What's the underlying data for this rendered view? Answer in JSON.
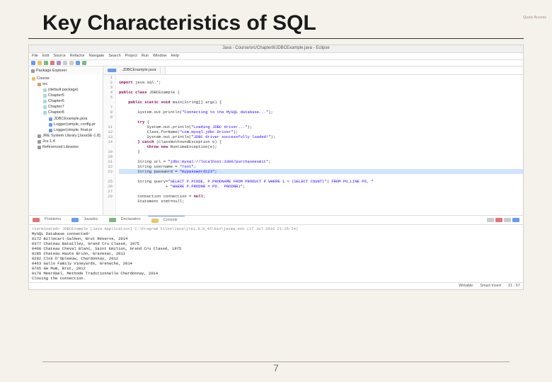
{
  "slide": {
    "title": "Key Characteristics of SQL",
    "page_number": "7"
  },
  "ide": {
    "window_title": "Java - Course/src/Chapter8/JDBCExample.java - Eclipse",
    "menu": [
      "File",
      "Edit",
      "Source",
      "Refactor",
      "Navigate",
      "Search",
      "Project",
      "Run",
      "Window",
      "Help"
    ],
    "quick_access": "Quick Access",
    "pkg_explorer": {
      "title": "Package Explorer",
      "project": "Course",
      "src": "src",
      "items": [
        "(default package)",
        "Chapter5",
        "Chapter6",
        "Chapter7",
        "Chapter8"
      ],
      "files": [
        "JDBCExample.java",
        "Logger(simple, config.pr",
        "Logger(simple, final.pr"
      ],
      "libs": [
        "JRE System Library [JavaSE-1.8]",
        "Jcs-1.4",
        "Referenced Libraries"
      ]
    },
    "tab_label": "JDBCExample.java",
    "lines": [
      "1",
      "2",
      "3",
      "4",
      "5",
      "",
      "7",
      "8",
      "9",
      "",
      "11",
      "12",
      "13",
      "14",
      "",
      "19",
      "20",
      "21",
      "22",
      "23",
      "",
      "25",
      "26",
      "27",
      "28"
    ],
    "code": {
      "l2": {
        "k": "import",
        "t": " java.sql.*;"
      },
      "l4": {
        "k": "public class",
        "t": " JDBCExample {"
      },
      "l7": {
        "k": "public static void",
        "t": " main(String[] args) {"
      },
      "l8": {
        "p": "        System.out.println(",
        "s": "\"Connecting to the MySQL database...\"",
        ");": ");"
      },
      "l9": {
        "k": "        try",
        "t": " {"
      },
      "l11": {
        "p": "            System.out.println(",
        "s": "\"Loading JDBC driver...\"",
        "e": ");"
      },
      "l12": {
        "p": "            Class.forName(",
        "s": "\"com.mysql.jdbc.Driver\"",
        "e": ");"
      },
      "l13": {
        "p": "            System.out.println(",
        "s": "\"JDBC driver successfully loaded!\"",
        "e": ");"
      },
      "l14a": {
        "k": "        } catch",
        "t": " (ClassNotFoundException e) {"
      },
      "l14b": {
        "k": "            throw new",
        "t": " RuntimeException(e);"
      },
      "l15": {
        "t": "        }"
      },
      "l19": {
        "p": "        String url = ",
        "s": "\"jdbc:mysql://localhost:3306/purchaseexmit\"",
        "e": ";"
      },
      "l20": {
        "p": "        String username = ",
        "s": "\"root\"",
        "e": ";"
      },
      "l21": {
        "p": "        String password = ",
        "s": "\"mypassword123\"",
        "e": ";"
      },
      "l23a": {
        "p": "        String query=",
        "s": "\"SELECT P.PCODE, P.PRODNAME FROM PRODUCT P WHERE 1 < (SELECT COUNT(*) FROM PO_LINE PO, \""
      },
      "l23b": {
        "p": "                    + ",
        "s": "\"WHERE P.PRODNR = PO.  PRODNR)\"",
        "e": ";"
      },
      "l25": {
        "p": "        Connection connection = ",
        "k": "null",
        "e": ";"
      },
      "l26": {
        "p": "        Statement stmt=null;"
      }
    },
    "bottom_tabs": [
      "Problems",
      "Javadoc",
      "Declaration",
      "Console"
    ],
    "console": {
      "term": "<terminated> JDBCExample [Java Application] C:\\Program Files\\Java\\jre1.8.0_45\\bin\\javaw.exe (27 Jul 2016 21:25:24)",
      "lines": [
        "MySQL Database connected!",
        "0172  Billecart-Salmon, Brut Réserve, 2014",
        "0377  Chateau Batailley, Grand Cru Classé, 1975",
        "0468  Chateau Cheval Blanc, Saint Emilion, Grand Cru Classé, 1975",
        "0185  Chateau Haute Brion, Gravesac, 2011",
        "0282  Clos D'Opleeuw, Chardonnay, 2012",
        "0463  Gallo Family Vineyards, Grenache, 2014",
        "0765  GH Mum, Brut, 2012",
        "0178  Meerdael, Methode Traditionnelle Chardonnay, 2014",
        "Closing the connection."
      ]
    },
    "status": {
      "write": "Writable",
      "ins": "Smart Insert",
      "pos": "21 : 57"
    }
  }
}
